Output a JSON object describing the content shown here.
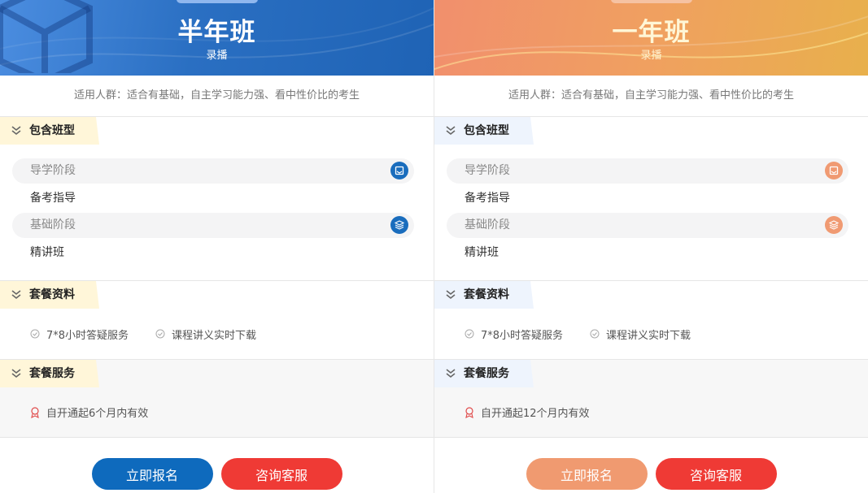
{
  "colors": {
    "left_accent": "#0e6abd",
    "right_accent": "#f09a70",
    "consult_red": "#ef3a35"
  },
  "plans": [
    {
      "title": "半年班",
      "subtitle": "录播",
      "audience": "适用人群：适合有基础，自主学习能力强、看中性价比的考生",
      "sections": {
        "classes_title": "包含班型",
        "stages": [
          {
            "name": "导学阶段",
            "icon": "book-icon",
            "item": "备考指导"
          },
          {
            "name": "基础阶段",
            "icon": "layers-icon",
            "item": "精讲班"
          }
        ],
        "materials_title": "套餐资料",
        "materials": [
          "7*8小时答疑服务",
          "课程讲义实时下载"
        ],
        "services_title": "套餐服务",
        "service": "自开通起6个月内有效"
      },
      "buttons": {
        "enroll": "立即报名",
        "consult": "咨询客服"
      }
    },
    {
      "title": "一年班",
      "subtitle": "录播",
      "audience": "适用人群：适合有基础，自主学习能力强、看中性价比的考生",
      "sections": {
        "classes_title": "包含班型",
        "stages": [
          {
            "name": "导学阶段",
            "icon": "book-icon",
            "item": "备考指导"
          },
          {
            "name": "基础阶段",
            "icon": "layers-icon",
            "item": "精讲班"
          }
        ],
        "materials_title": "套餐资料",
        "materials": [
          "7*8小时答疑服务",
          "课程讲义实时下载"
        ],
        "services_title": "套餐服务",
        "service": "自开通起12个月内有效"
      },
      "buttons": {
        "enroll": "立即报名",
        "consult": "咨询客服"
      }
    }
  ]
}
